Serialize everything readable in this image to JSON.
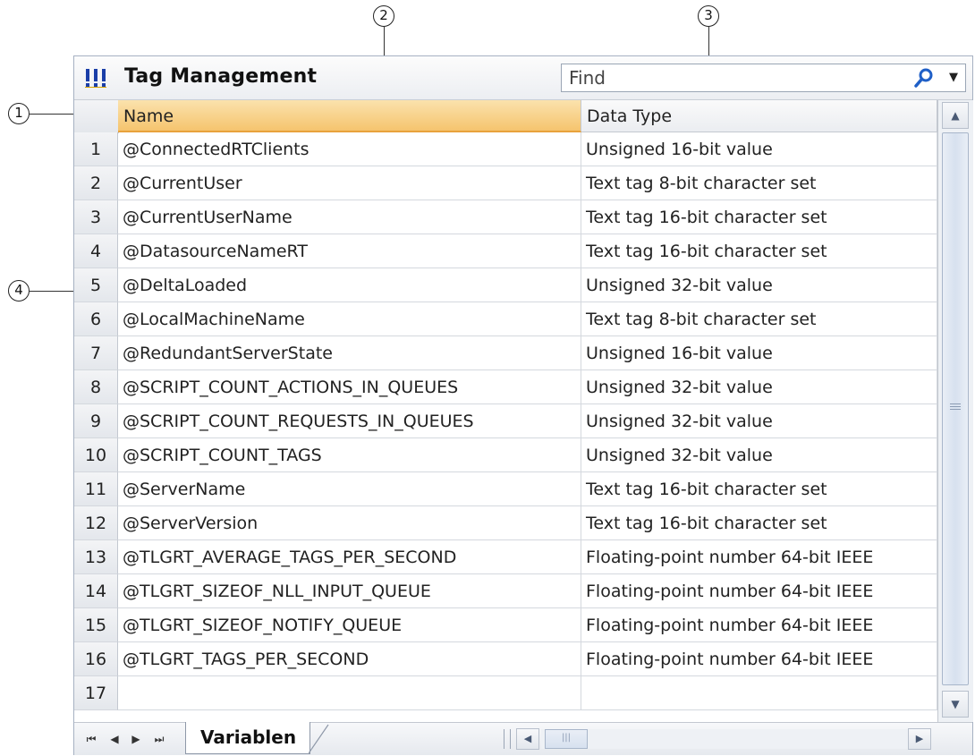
{
  "callouts": {
    "c1": "1",
    "c2": "2",
    "c3": "3",
    "c4": "4"
  },
  "window": {
    "title": "Tag Management",
    "icon": "tag-management-icon"
  },
  "find": {
    "placeholder": "Find",
    "search_icon": "search-icon",
    "dropdown_icon": "chevron-down-icon"
  },
  "columns": {
    "name": "Name",
    "type": "Data Type"
  },
  "rows": [
    {
      "num": "1",
      "name": "@ConnectedRTClients",
      "type": "Unsigned 16-bit value"
    },
    {
      "num": "2",
      "name": "@CurrentUser",
      "type": "Text tag 8-bit character set"
    },
    {
      "num": "3",
      "name": "@CurrentUserName",
      "type": "Text tag 16-bit character set"
    },
    {
      "num": "4",
      "name": "@DatasourceNameRT",
      "type": "Text tag 16-bit character set"
    },
    {
      "num": "5",
      "name": "@DeltaLoaded",
      "type": "Unsigned 32-bit value"
    },
    {
      "num": "6",
      "name": "@LocalMachineName",
      "type": "Text tag 8-bit character set"
    },
    {
      "num": "7",
      "name": "@RedundantServerState",
      "type": "Unsigned 16-bit value"
    },
    {
      "num": "8",
      "name": "@SCRIPT_COUNT_ACTIONS_IN_QUEUES",
      "type": "Unsigned 32-bit value"
    },
    {
      "num": "9",
      "name": "@SCRIPT_COUNT_REQUESTS_IN_QUEUES",
      "type": "Unsigned 32-bit value"
    },
    {
      "num": "10",
      "name": "@SCRIPT_COUNT_TAGS",
      "type": "Unsigned 32-bit value"
    },
    {
      "num": "11",
      "name": "@ServerName",
      "type": "Text tag 16-bit character set"
    },
    {
      "num": "12",
      "name": "@ServerVersion",
      "type": "Text tag 16-bit character set"
    },
    {
      "num": "13",
      "name": "@TLGRT_AVERAGE_TAGS_PER_SECOND",
      "type": "Floating-point number 64-bit IEEE"
    },
    {
      "num": "14",
      "name": "@TLGRT_SIZEOF_NLL_INPUT_QUEUE",
      "type": "Floating-point number 64-bit IEEE"
    },
    {
      "num": "15",
      "name": "@TLGRT_SIZEOF_NOTIFY_QUEUE",
      "type": "Floating-point number 64-bit IEEE"
    },
    {
      "num": "16",
      "name": "@TLGRT_TAGS_PER_SECOND",
      "type": "Floating-point number 64-bit IEEE"
    },
    {
      "num": "17",
      "name": "",
      "type": ""
    }
  ],
  "sheet_tabs": {
    "active": "Variablen"
  },
  "colors": {
    "header_active": "#f5c46e",
    "header_accent": "#e8a23c",
    "grid_line": "#d4d8de",
    "icon_blue": "#1a3ea8"
  }
}
